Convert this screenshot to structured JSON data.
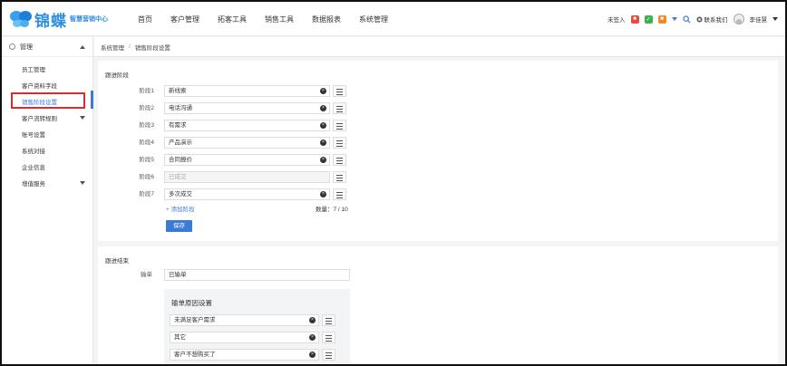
{
  "header": {
    "logo_text": "锦蝶",
    "logo_sub": "智慧营销中心",
    "nav": [
      "首页",
      "客户管理",
      "拓客工具",
      "销售工具",
      "数据报表",
      "系统管理"
    ],
    "checkin": "未签入",
    "contact": "联系我们",
    "user": "李佳慧"
  },
  "sidebar": {
    "head": "管理",
    "items": [
      "员工管理",
      "客户资料字段",
      "销售阶段设置",
      "客户流转规则",
      "账号设置",
      "系统对接",
      "企业信息",
      "增值服务"
    ],
    "active_index": 2
  },
  "breadcrumb": [
    "系统管理",
    "销售阶段设置"
  ],
  "stages": {
    "title": "跟进阶段",
    "rows": [
      {
        "label": "阶段1",
        "value": "新线索",
        "disabled": false
      },
      {
        "label": "阶段2",
        "value": "电话沟通",
        "disabled": false
      },
      {
        "label": "阶段3",
        "value": "有需求",
        "disabled": false
      },
      {
        "label": "阶段4",
        "value": "产品演示",
        "disabled": false
      },
      {
        "label": "阶段5",
        "value": "合同报价",
        "disabled": false
      },
      {
        "label": "阶段6",
        "value": "已成交",
        "disabled": true
      },
      {
        "label": "阶段7",
        "value": "多次成交",
        "disabled": false
      }
    ],
    "add_label": "+ 添加阶段",
    "count_label": "数量：7 / 10",
    "save_label": "保存"
  },
  "end": {
    "title": "跟进结束",
    "lose_label": "输单",
    "lose_value": "已输单",
    "reasons_title": "输单原因设置",
    "reasons": [
      "未满足客户需求",
      "其它",
      "客户不想购买了"
    ]
  },
  "colors": {
    "accent": "#3a7bd5",
    "highlight": "#d92c2c"
  }
}
